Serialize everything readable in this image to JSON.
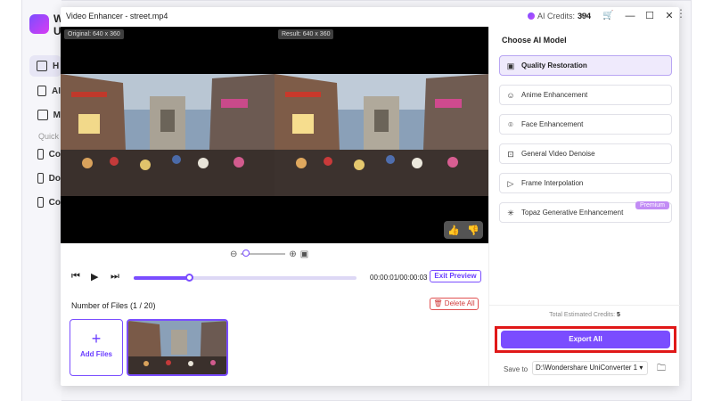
{
  "background_app": {
    "logo_text_top": "W",
    "logo_text_bottom": "U",
    "nav": [
      {
        "label": "H",
        "icon": "home-icon"
      },
      {
        "label": "AI",
        "icon": "ai-icon"
      },
      {
        "label": "M",
        "icon": "media-icon"
      },
      {
        "label": "Co",
        "icon": "convert-icon"
      },
      {
        "label": "Do",
        "icon": "download-icon"
      },
      {
        "label": "Co",
        "icon": "screen-icon"
      }
    ],
    "quick_label": "Quick A"
  },
  "dialog": {
    "title": "Video Enhancer - street.mp4",
    "credits_label": "AI Credits:",
    "credits_value": "394"
  },
  "preview": {
    "original_tag": "Original: 640 x 360",
    "result_tag": "Result: 640 x 360"
  },
  "playback": {
    "progress_fraction": 0.25,
    "time": "00:00:01/00:00:03",
    "exit_preview": "Exit Preview"
  },
  "files": {
    "count_label": "Number of Files (1 / 20)",
    "delete_all": "Delete All",
    "add_files": "Add Files"
  },
  "models": {
    "title": "Choose AI Model",
    "items": [
      {
        "label": "Quality Restoration",
        "icon": "hd-icon",
        "selected": true
      },
      {
        "label": "Anime Enhancement",
        "icon": "anime-icon",
        "selected": false
      },
      {
        "label": "Face Enhancement",
        "icon": "face-icon",
        "selected": false
      },
      {
        "label": "General Video Denoise",
        "icon": "denoise-icon",
        "selected": false
      },
      {
        "label": "Frame Interpolation",
        "icon": "frame-icon",
        "selected": false
      },
      {
        "label": "Topaz Generative Enhancement",
        "icon": "topaz-icon",
        "selected": false,
        "badge": "Premium"
      }
    ]
  },
  "footer": {
    "estimated_label": "Total Estimated Credits:",
    "estimated_value": "5",
    "export_all": "Export All",
    "save_to_label": "Save to",
    "save_path": "D:\\Wondershare UniConverter 1"
  },
  "colors": {
    "accent": "#7a4dff",
    "highlight": "#e01818"
  }
}
